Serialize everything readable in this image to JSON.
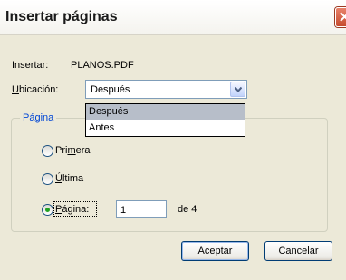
{
  "window": {
    "title": "Insertar páginas"
  },
  "insert": {
    "label": "Insertar:",
    "file": "PLANOS.PDF"
  },
  "location": {
    "label_u": "U",
    "label_rest": "bicación:",
    "selected": "Después",
    "options": [
      "Después",
      "Antes"
    ]
  },
  "page_group": {
    "legend": "Página",
    "first": {
      "pre": "Pri",
      "u": "m",
      "post": "era",
      "checked": false
    },
    "last": {
      "u": "Ú",
      "post": "ltima",
      "checked": false
    },
    "page": {
      "u": "P",
      "post": "ágina:",
      "checked": true,
      "value": "1",
      "of_label": "de 4"
    }
  },
  "buttons": {
    "accept": "Aceptar",
    "cancel": "Cancelar"
  },
  "colors": {
    "group_legend": "#0046d5",
    "dialog_bg": "#ece9d8",
    "highlight": "#b7bec9"
  }
}
